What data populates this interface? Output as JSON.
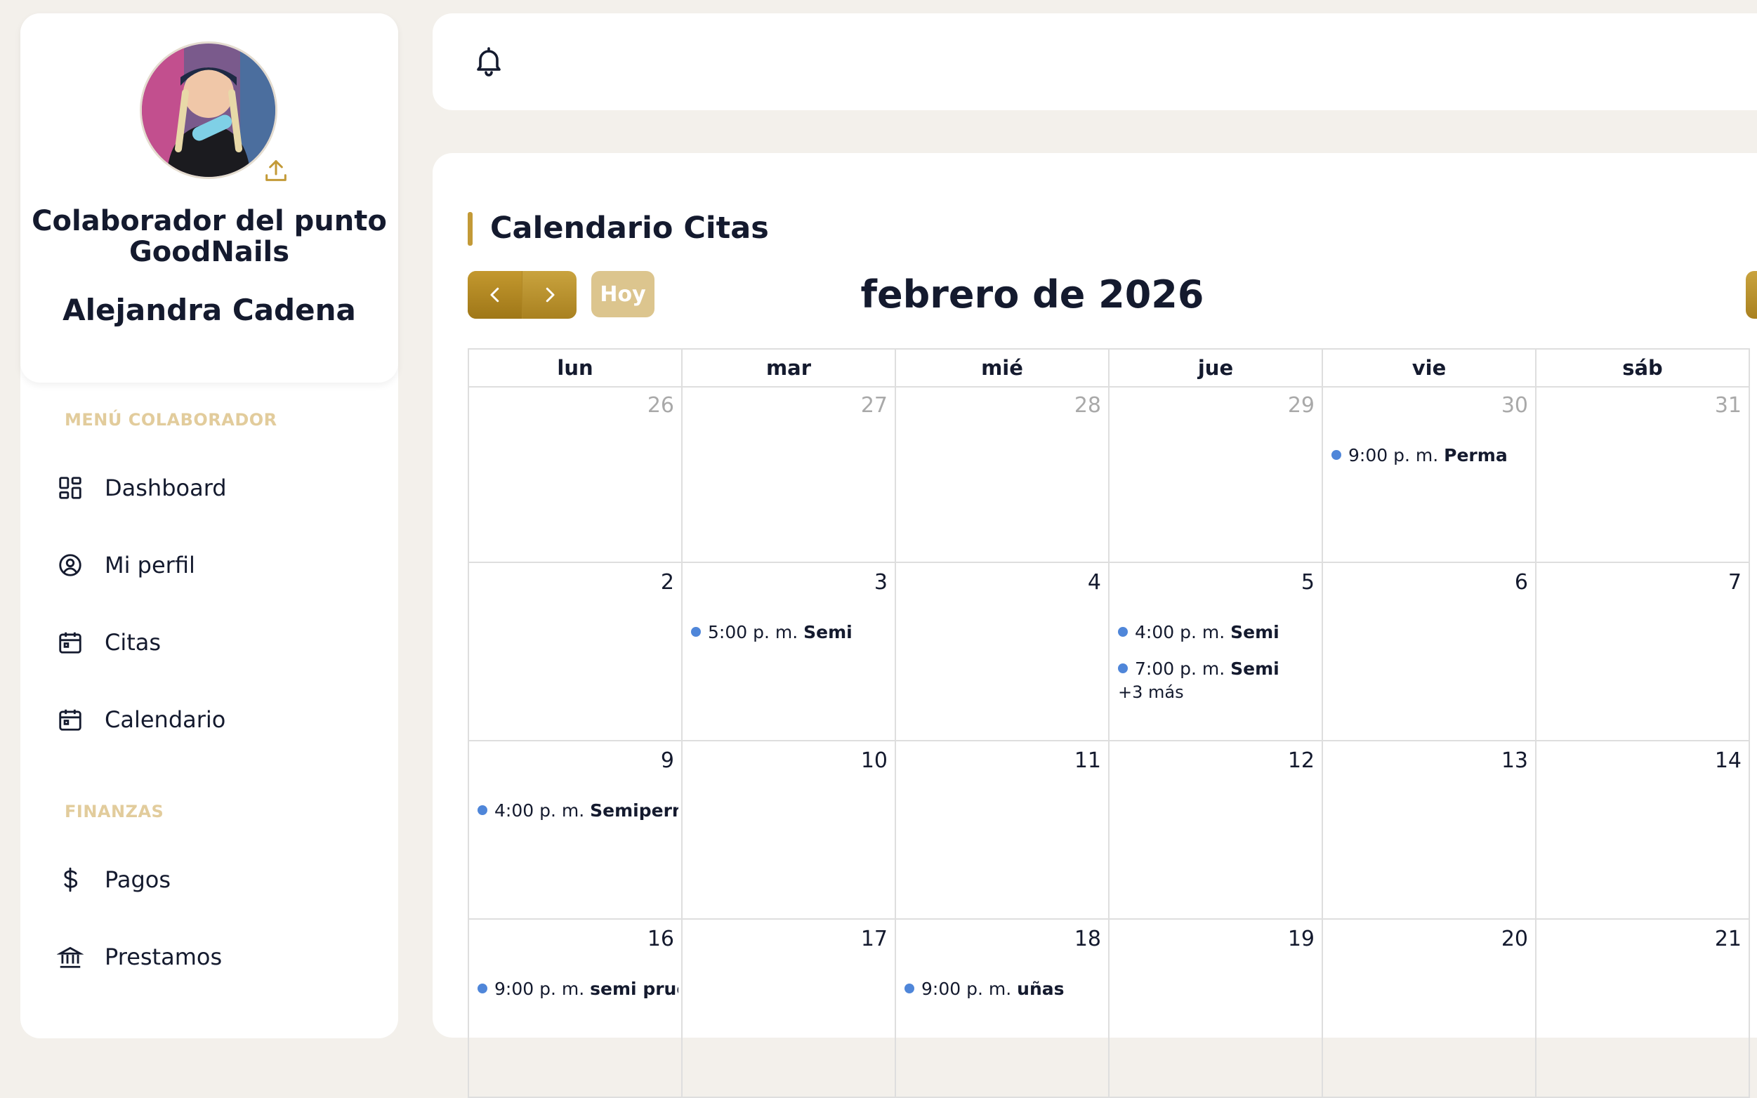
{
  "sidebar": {
    "role_title": "Colaborador del punto GoodNails",
    "user_name": "Alejandra Cadena",
    "menu_label": "MENÚ COLABORADOR",
    "menu_items": [
      {
        "label": "Dashboard",
        "icon": "dashboard-icon"
      },
      {
        "label": "Mi perfil",
        "icon": "user-circle-icon"
      },
      {
        "label": "Citas",
        "icon": "calendar-icon"
      },
      {
        "label": "Calendario",
        "icon": "calendar-icon"
      }
    ],
    "finance_label": "FINANZAS",
    "finance_items": [
      {
        "label": "Pagos",
        "icon": "dollar-icon"
      },
      {
        "label": "Prestamos",
        "icon": "bank-icon"
      }
    ]
  },
  "main": {
    "title": "Calendario Citas",
    "today_label": "Hoy",
    "month": "febrero de 2026",
    "weekdays": [
      "lun",
      "mar",
      "mié",
      "jue",
      "vie",
      "sáb"
    ],
    "weeks": [
      [
        {
          "day": "26",
          "other": true,
          "events": []
        },
        {
          "day": "27",
          "other": true,
          "events": []
        },
        {
          "day": "28",
          "other": true,
          "events": []
        },
        {
          "day": "29",
          "other": true,
          "events": []
        },
        {
          "day": "30",
          "other": true,
          "events": [
            {
              "time": "9:00 p. m.",
              "label": "Perma"
            }
          ]
        },
        {
          "day": "31",
          "other": true,
          "events": []
        }
      ],
      [
        {
          "day": "2",
          "events": []
        },
        {
          "day": "3",
          "events": [
            {
              "time": "5:00 p. m.",
              "label": "Semi"
            }
          ]
        },
        {
          "day": "4",
          "events": []
        },
        {
          "day": "5",
          "events": [
            {
              "time": "4:00 p. m.",
              "label": "Semi"
            },
            {
              "time": "7:00 p. m.",
              "label": "Semi"
            }
          ],
          "more": "+3 más"
        },
        {
          "day": "6",
          "events": []
        },
        {
          "day": "7",
          "events": []
        }
      ],
      [
        {
          "day": "9",
          "events": [
            {
              "time": "4:00 p. m.",
              "label": "Semipermar"
            }
          ]
        },
        {
          "day": "10",
          "events": []
        },
        {
          "day": "11",
          "events": []
        },
        {
          "day": "12",
          "events": []
        },
        {
          "day": "13",
          "events": []
        },
        {
          "day": "14",
          "events": []
        }
      ],
      [
        {
          "day": "16",
          "events": [
            {
              "time": "9:00 p. m.",
              "label": "semi prueba"
            }
          ]
        },
        {
          "day": "17",
          "events": []
        },
        {
          "day": "18",
          "events": [
            {
              "time": "9:00 p. m.",
              "label": "uñas"
            }
          ]
        },
        {
          "day": "19",
          "events": []
        },
        {
          "day": "20",
          "events": []
        },
        {
          "day": "21",
          "events": []
        }
      ]
    ]
  },
  "colors": {
    "accent_gold": "#c39a37",
    "event_dot": "#4f86d9",
    "section_label": "#e2cc9c"
  }
}
